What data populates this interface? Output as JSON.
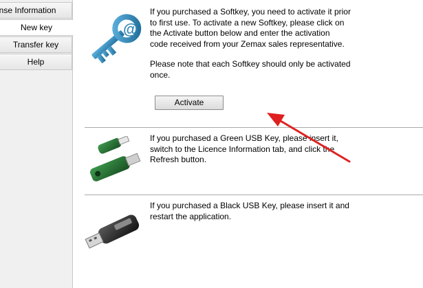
{
  "tabs": [
    {
      "label": "ense Information"
    },
    {
      "label": "New key"
    },
    {
      "label": "Transfer key"
    },
    {
      "label": "Help"
    }
  ],
  "softkey": {
    "text": "If you purchased a Softkey, you need to activate it prior\nto first use. To activate a new Softkey, please click on\nthe Activate button below and enter the activation\ncode received from your Zemax sales representative.",
    "note": "Please note that each Softkey should only be activated\nonce.",
    "button_label": "Activate",
    "icon": "key-at-icon",
    "icon_color": "#2f86b8"
  },
  "green_usb": {
    "text": "If you purchased a Green USB Key, please insert it,\nswitch to the Licence Information tab, and click the\nRefresh button.",
    "icon": "green-usb-key-icon",
    "icon_color": "#1f6b2c"
  },
  "black_usb": {
    "text": "If you purchased a Black USB Key, please insert it and\nrestart the application.",
    "icon": "black-usb-key-icon",
    "icon_color": "#2a2a2a"
  },
  "annotation": {
    "arrow_color": "#e02020"
  }
}
